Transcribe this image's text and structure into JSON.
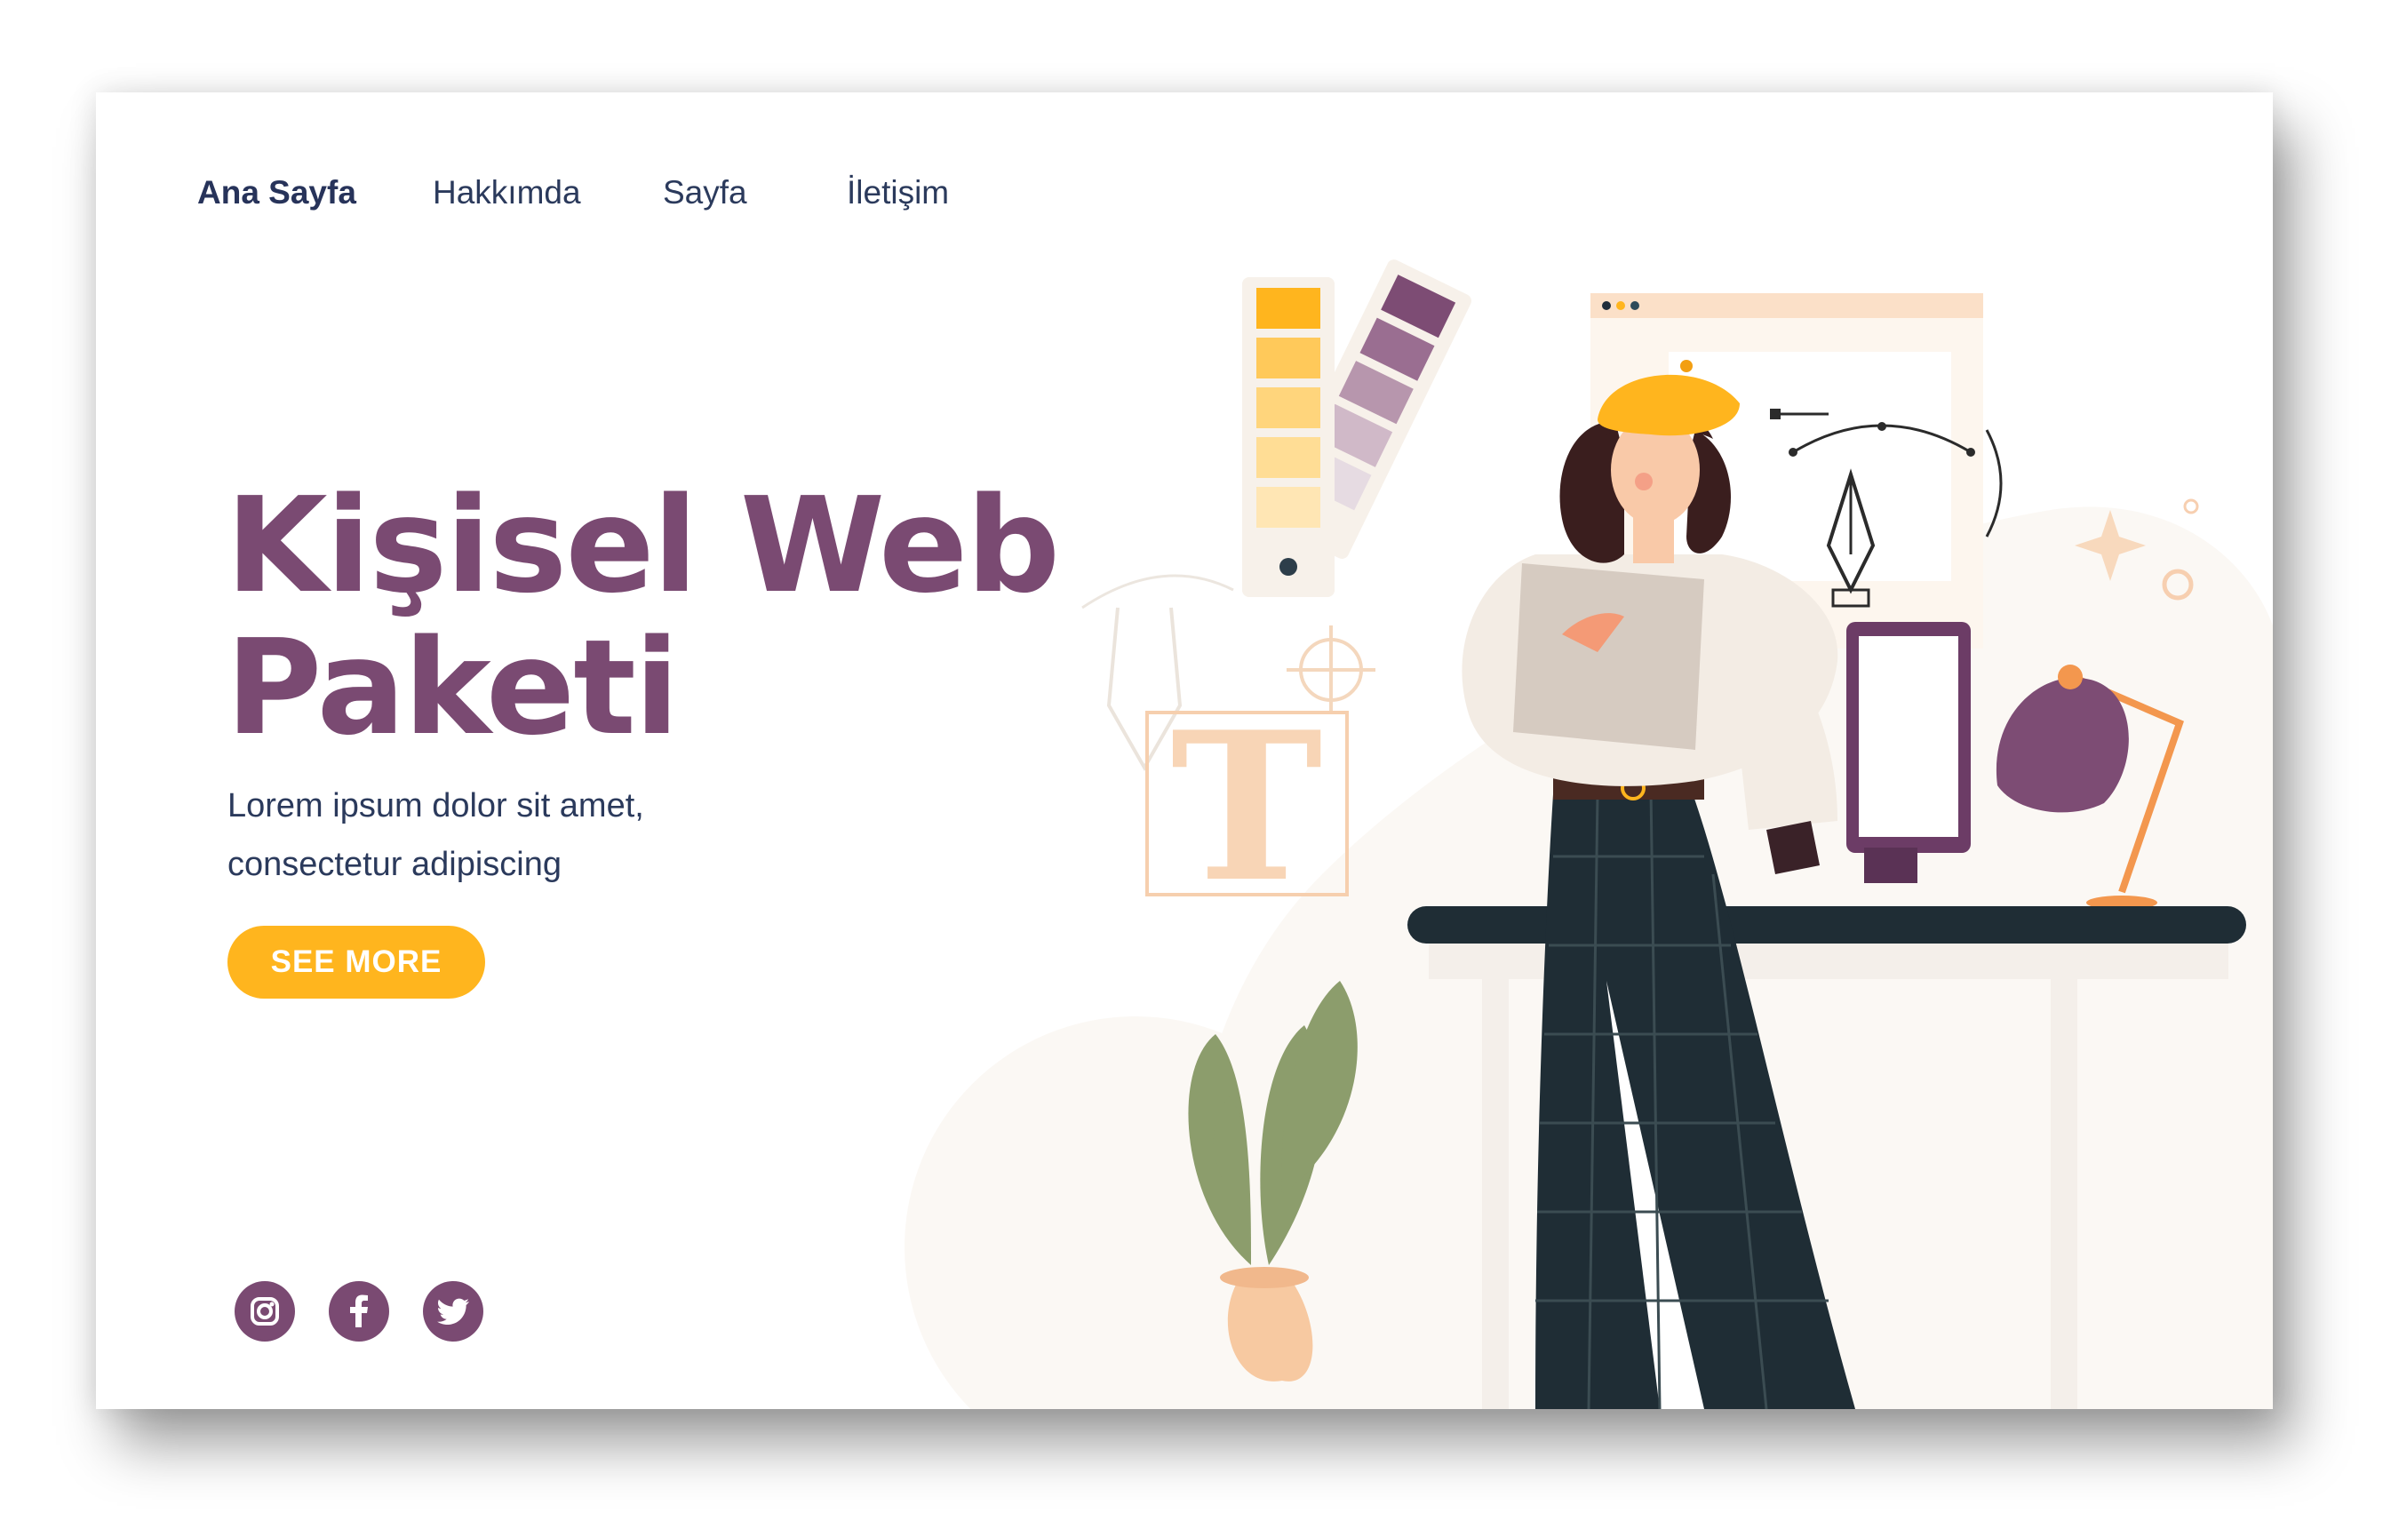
{
  "nav": {
    "home": "Ana Sayfa",
    "about": "Hakkımda",
    "page": "Sayfa",
    "contact": "İletişim"
  },
  "hero": {
    "title_line1": "Kişisel Web",
    "title_line2": "Paketi",
    "subtitle_line1": "Lorem ipsum dolor sit amet,",
    "subtitle_line2": "consectetur adipiscing",
    "cta_label": "SEE MORE"
  },
  "illustration": {
    "type_glyph": "T"
  },
  "social": {
    "icons": [
      "instagram-icon",
      "facebook-icon",
      "twitter-icon"
    ]
  },
  "colors": {
    "accent": "#7a4a72",
    "button": "#ffb51e",
    "text": "#2b3a5c"
  }
}
